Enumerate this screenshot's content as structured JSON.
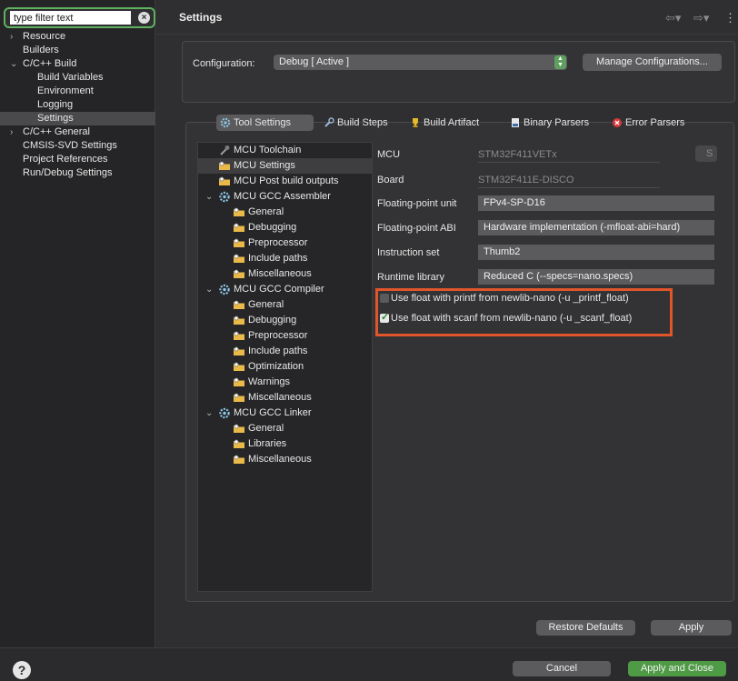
{
  "sidebar": {
    "filter_value": "type filter text",
    "items": [
      {
        "label": "Resource",
        "caret": "›"
      },
      {
        "label": "Builders",
        "caret": ""
      },
      {
        "label": "C/C++ Build",
        "caret": "⌄"
      },
      {
        "label": "Build Variables",
        "caret": ""
      },
      {
        "label": "Environment",
        "caret": ""
      },
      {
        "label": "Logging",
        "caret": ""
      },
      {
        "label": "Settings",
        "caret": ""
      },
      {
        "label": "C/C++ General",
        "caret": "›"
      },
      {
        "label": "CMSIS-SVD Settings",
        "caret": ""
      },
      {
        "label": "Project References",
        "caret": ""
      },
      {
        "label": "Run/Debug Settings",
        "caret": ""
      }
    ]
  },
  "header": {
    "title": "Settings",
    "back_icon": "arrow-left-icon",
    "forward_icon": "arrow-right-icon",
    "menu_icon": "kebab-menu-icon"
  },
  "configuration": {
    "label": "Configuration:",
    "value": "Debug  [ Active ]",
    "manage_label": "Manage Configurations..."
  },
  "tabs": [
    {
      "label": "Tool Settings",
      "icon": "gear-icon"
    },
    {
      "label": "Build Steps",
      "icon": "wrench-icon"
    },
    {
      "label": "Build Artifact",
      "icon": "trophy-icon"
    },
    {
      "label": "Binary Parsers",
      "icon": "binary-file-icon"
    },
    {
      "label": "Error Parsers",
      "icon": "error-icon"
    }
  ],
  "tool_tree": [
    {
      "label": "MCU Toolchain",
      "icon": "toolchain-icon"
    },
    {
      "label": "MCU Settings",
      "icon": "folder-icon"
    },
    {
      "label": "MCU Post build outputs",
      "icon": "folder-icon"
    },
    {
      "label": "MCU GCC Assembler",
      "icon": "gear-icon"
    },
    {
      "label": "General",
      "icon": "folder-icon"
    },
    {
      "label": "Debugging",
      "icon": "folder-icon"
    },
    {
      "label": "Preprocessor",
      "icon": "folder-icon"
    },
    {
      "label": "Include paths",
      "icon": "folder-icon"
    },
    {
      "label": "Miscellaneous",
      "icon": "folder-icon"
    },
    {
      "label": "MCU GCC Compiler",
      "icon": "gear-icon"
    },
    {
      "label": "General",
      "icon": "folder-icon"
    },
    {
      "label": "Debugging",
      "icon": "folder-icon"
    },
    {
      "label": "Preprocessor",
      "icon": "folder-icon"
    },
    {
      "label": "Include paths",
      "icon": "folder-icon"
    },
    {
      "label": "Optimization",
      "icon": "folder-icon"
    },
    {
      "label": "Warnings",
      "icon": "folder-icon"
    },
    {
      "label": "Miscellaneous",
      "icon": "folder-icon"
    },
    {
      "label": "MCU GCC Linker",
      "icon": "gear-icon"
    },
    {
      "label": "General",
      "icon": "folder-icon"
    },
    {
      "label": "Libraries",
      "icon": "folder-icon"
    },
    {
      "label": "Miscellaneous",
      "icon": "folder-icon"
    }
  ],
  "tool_tree_carets": [
    "⌄",
    "⌄",
    "⌄"
  ],
  "properties": {
    "mcu_label": "MCU",
    "mcu_value": "STM32F411VETx",
    "select_btn": "S",
    "board_label": "Board",
    "board_value": "STM32F411E-DISCO",
    "fpu_label": "Floating-point unit",
    "fpu_value": "FPv4-SP-D16",
    "fpabi_label": "Floating-point ABI",
    "fpabi_value": "Hardware implementation (-mfloat-abi=hard)",
    "iset_label": "Instruction set",
    "iset_value": "Thumb2",
    "runtime_label": "Runtime library",
    "runtime_value": "Reduced C (--specs=nano.specs)",
    "printf_label": "Use float with printf from newlib-nano (-u _printf_float)",
    "printf_checked": false,
    "scanf_label": "Use float with scanf from newlib-nano (-u _scanf_float)",
    "scanf_checked": true
  },
  "buttons": {
    "restore": "Restore Defaults",
    "apply": "Apply",
    "cancel": "Cancel",
    "apply_close": "Apply and Close",
    "help": "?"
  },
  "colors": {
    "accent_green": "#4e9a45",
    "highlight": "#e1552a",
    "filter_border": "#5fb05f"
  }
}
